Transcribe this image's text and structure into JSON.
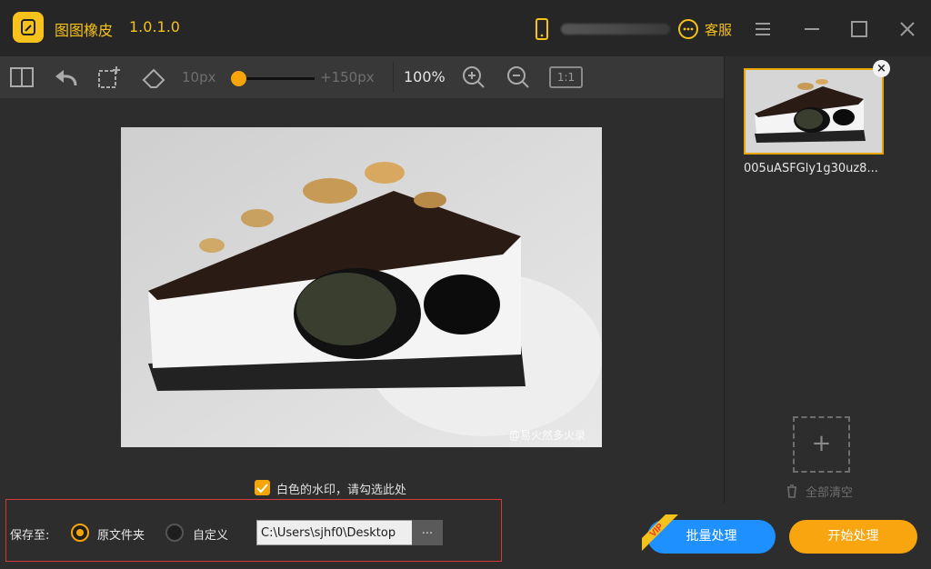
{
  "titlebar": {
    "app_name": "图图橡皮",
    "version": "1.0.1.0",
    "service_label": "客服"
  },
  "toolbar": {
    "brush_min": "10px",
    "brush_max": "+150px",
    "zoom": "100%",
    "ratio": "1:1",
    "brush_size_fraction": 0.05
  },
  "canvas": {
    "photo_watermark": "@易火然多火录",
    "watermark_option": "白色的水印，请勾选此处"
  },
  "rightpanel": {
    "thumb_name": "005uASFGly1g30uz8...",
    "clear_all": "全部清空"
  },
  "bottombar": {
    "save_to_label": "保存至:",
    "option_original": "原文件夹",
    "option_custom": "自定义",
    "path_value": "C:\\Users\\sjhf0\\Desktop",
    "browse_label": "...",
    "batch_button": "批量处理",
    "vip_badge": "VIP",
    "start_button": "开始处理"
  },
  "colors": {
    "accent": "#f5a50a",
    "brand_yellow": "#f5c11b",
    "batch_blue": "#1e90ff",
    "highlight_red": "#d23b3b"
  },
  "icons": [
    "compare-view-icon",
    "undo-icon",
    "crop-icon",
    "eraser-icon",
    "zoom-in-icon",
    "zoom-out-icon",
    "phone-icon",
    "chat-icon",
    "menu-icon",
    "maximize-icon",
    "close-icon",
    "trash-icon",
    "plus-icon",
    "check-icon"
  ]
}
